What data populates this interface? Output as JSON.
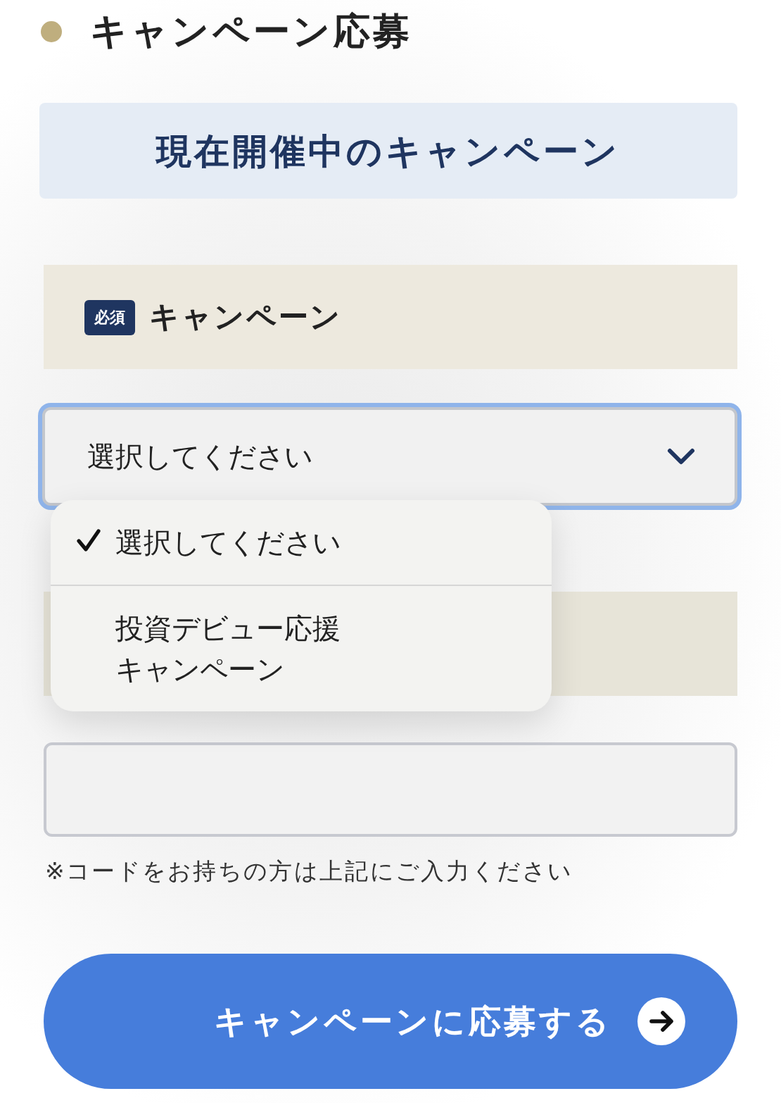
{
  "heading": "キャンペーン応募",
  "banner": "現在開催中のキャンペーン",
  "campaign_field": {
    "required_badge": "必須",
    "label": "キャンペーン",
    "value": "選択してください",
    "expanded": true,
    "options": [
      {
        "label": "選択してください",
        "selected": true
      },
      {
        "label": "投資デビュー応援キャンペーン",
        "selected": false
      }
    ]
  },
  "code_field": {
    "note": "※コードをお持ちの方は上記にご入力ください"
  },
  "submit_button": "キャンペーンに応募する"
}
